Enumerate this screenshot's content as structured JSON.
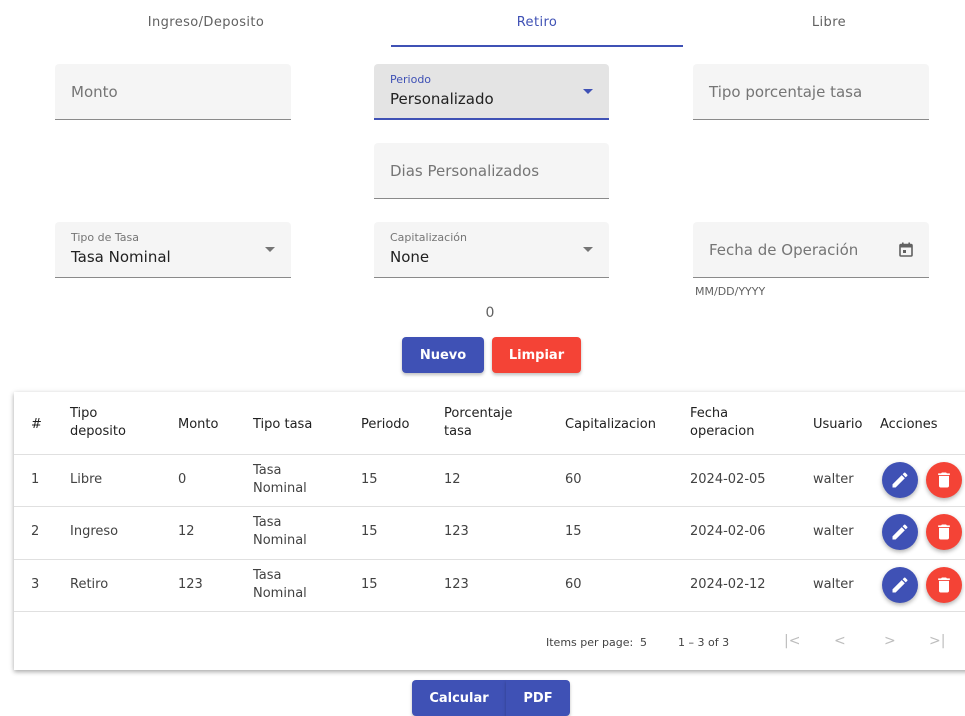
{
  "tabs": [
    {
      "label": "Ingreso/Deposito",
      "active": false
    },
    {
      "label": "Retiro",
      "active": true
    },
    {
      "label": "Libre",
      "active": false
    }
  ],
  "form": {
    "monto_placeholder": "Monto",
    "periodo_label": "Periodo",
    "periodo_value": "Personalizado",
    "tipo_porcentaje_placeholder": "Tipo porcentaje tasa",
    "dias_placeholder": "Dias Personalizados",
    "tipo_tasa_label": "Tipo de Tasa",
    "tipo_tasa_value": "Tasa Nominal",
    "capitalizacion_label": "Capitalización",
    "capitalizacion_value": "None",
    "fecha_placeholder": "Fecha de Operación",
    "fecha_hint": "MM/DD/YYYY",
    "counter": "0"
  },
  "buttons": {
    "nuevo": "Nuevo",
    "limpiar": "Limpiar",
    "calcular": "Calcular",
    "pdf": "PDF"
  },
  "table": {
    "headers": {
      "num": "#",
      "tipo_deposito_1": "Tipo",
      "tipo_deposito_2": "deposito",
      "monto": "Monto",
      "tipo_tasa": "Tipo tasa",
      "periodo": "Periodo",
      "porcentaje_1": "Porcentaje",
      "porcentaje_2": "tasa",
      "capitalizacion": "Capitalizacion",
      "fecha_1": "Fecha",
      "fecha_2": "operacion",
      "usuario": "Usuario",
      "acciones": "Acciones"
    },
    "rows": [
      {
        "num": "1",
        "tipo": "Libre",
        "monto": "0",
        "tasa_1": "Tasa",
        "tasa_2": "Nominal",
        "periodo": "15",
        "porcentaje": "12",
        "capitalizacion": "60",
        "fecha": "2024-02-05",
        "usuario": "walter"
      },
      {
        "num": "2",
        "tipo": "Ingreso",
        "monto": "12",
        "tasa_1": "Tasa",
        "tasa_2": "Nominal",
        "periodo": "15",
        "porcentaje": "123",
        "capitalizacion": "15",
        "fecha": "2024-02-06",
        "usuario": "walter"
      },
      {
        "num": "3",
        "tipo": "Retiro",
        "monto": "123",
        "tasa_1": "Tasa",
        "tasa_2": "Nominal",
        "periodo": "15",
        "porcentaje": "123",
        "capitalizacion": "60",
        "fecha": "2024-02-12",
        "usuario": "walter"
      }
    ]
  },
  "paginator": {
    "items_per_page_label": "Items per page:",
    "items_per_page_value": "5",
    "range": "1 – 3 of 3"
  },
  "colors": {
    "primary": "#3f51b5",
    "warn": "#f44336"
  },
  "icons": [
    "calendar-icon",
    "dropdown-arrow-icon",
    "edit-icon",
    "delete-icon",
    "first-page-icon",
    "previous-page-icon",
    "next-page-icon",
    "last-page-icon"
  ]
}
